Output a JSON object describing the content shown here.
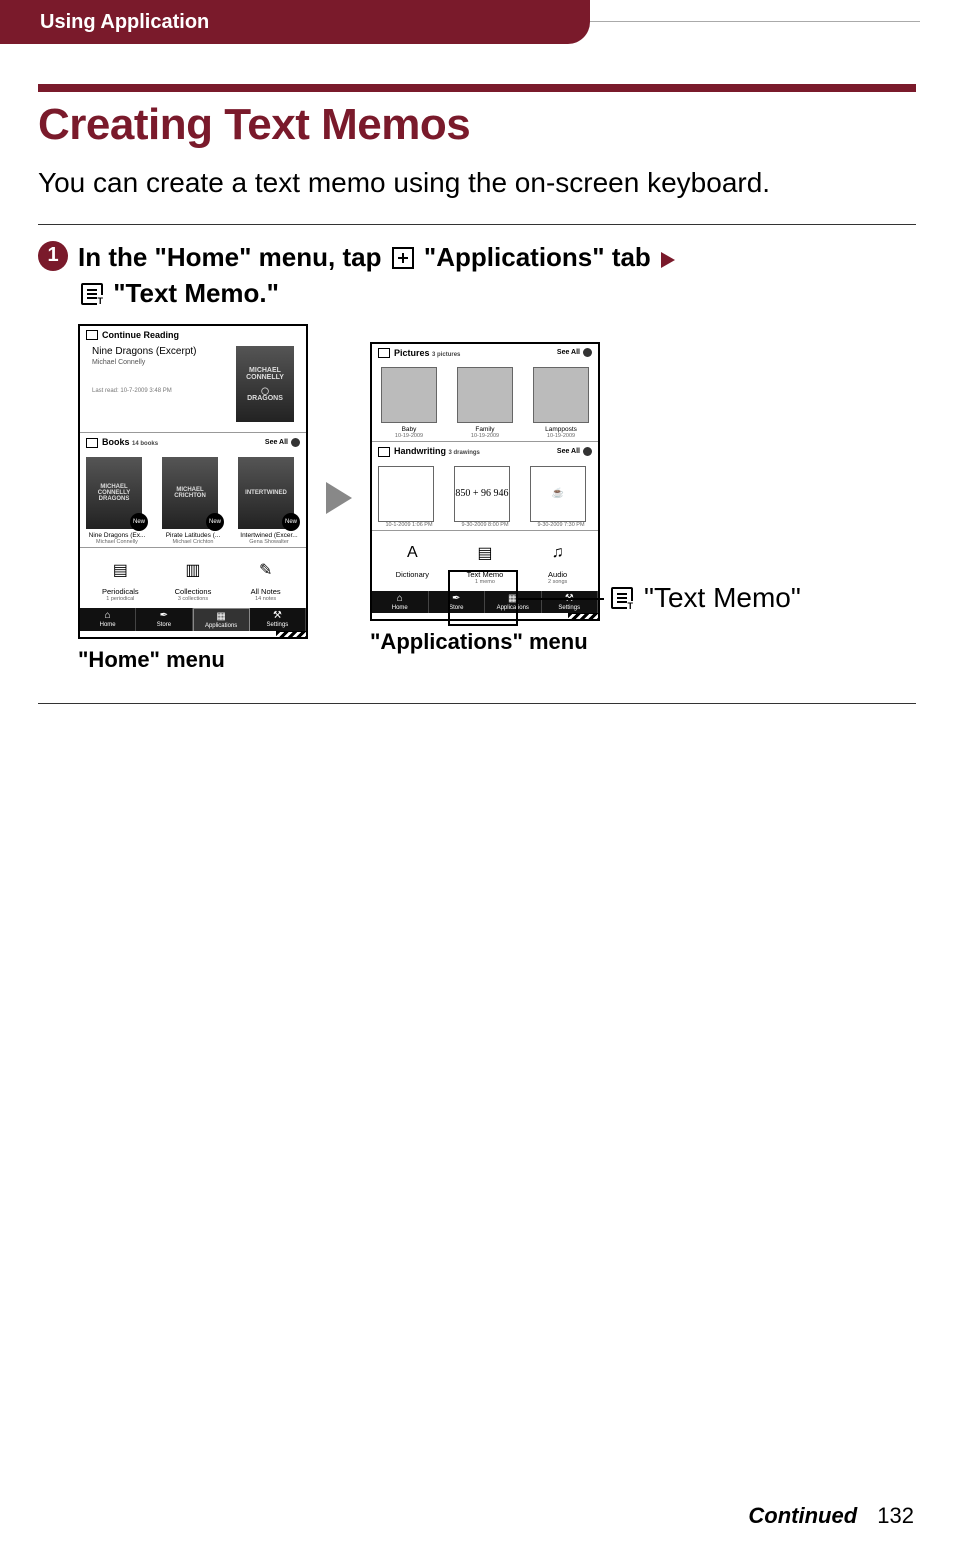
{
  "header": {
    "breadcrumb": "Using Application"
  },
  "title": "Creating Text Memos",
  "intro": "You can create a text memo using the on-screen keyboard.",
  "step1": {
    "number": "1",
    "part1": "In the \"Home\" menu, tap ",
    "apps_label": " \"Applications\" tab ",
    "part2": " \"Text Memo.\""
  },
  "home_screen": {
    "continue_reading": {
      "header": "Continue Reading",
      "title": "Nine Dragons (Excerpt)",
      "author": "Michael Connelly",
      "last_read": "Last read: 10-7-2009 3:48 PM",
      "cover_line1": "MICHAEL CONNELLY",
      "cover_line2": "DRAGONS"
    },
    "books": {
      "header": "Books",
      "sub": "14 books",
      "see_all": "See All",
      "items": [
        {
          "cover": "MICHAEL CONNELLY DRAGONS",
          "title": "Nine Dragons (Ex...",
          "author": "Michael Connelly",
          "new": true
        },
        {
          "cover": "MICHAEL CRICHTON",
          "title": "Pirate Latitudes (...",
          "author": "Michael Crichton",
          "new": true
        },
        {
          "cover": "INTERTWINED",
          "title": "Intertwined (Excer...",
          "author": "Gena Showalter",
          "new": true
        }
      ]
    },
    "apps": [
      {
        "label": "Periodicals",
        "sub": "1 periodical"
      },
      {
        "label": "Collections",
        "sub": "3 collections"
      },
      {
        "label": "All Notes",
        "sub": "14 notes"
      }
    ],
    "tabs": [
      "Home",
      "Store",
      "Applications",
      "Settings"
    ],
    "caption": "\"Home\" menu"
  },
  "apps_screen": {
    "pictures": {
      "header": "Pictures",
      "sub": "3 pictures",
      "see_all": "See All",
      "items": [
        {
          "title": "Baby",
          "date": "10-19-2009"
        },
        {
          "title": "Family",
          "date": "10-19-2009"
        },
        {
          "title": "Lampposts",
          "date": "10-19-2009"
        }
      ]
    },
    "handwriting": {
      "header": "Handwriting",
      "sub": "3 drawings",
      "see_all": "See All",
      "items": [
        {
          "date": "10-1-2009 1:06 PM",
          "scribble": ""
        },
        {
          "date": "9-30-2009 8:00 PM",
          "scribble": "850 + 96 946"
        },
        {
          "date": "9-30-2009 7:30 PM",
          "scribble": ""
        }
      ]
    },
    "apps": [
      {
        "label": "Dictionary",
        "sub": ""
      },
      {
        "label": "Text Memo",
        "sub": "1 memo"
      },
      {
        "label": "Audio",
        "sub": "2 songs"
      }
    ],
    "tabs": [
      "Home",
      "Store",
      "Applications",
      "Settings"
    ],
    "caption": "\"Applications\" menu"
  },
  "callout": {
    "label": "\"Text Memo\""
  },
  "footer": {
    "continued": "Continued",
    "page": "132"
  }
}
